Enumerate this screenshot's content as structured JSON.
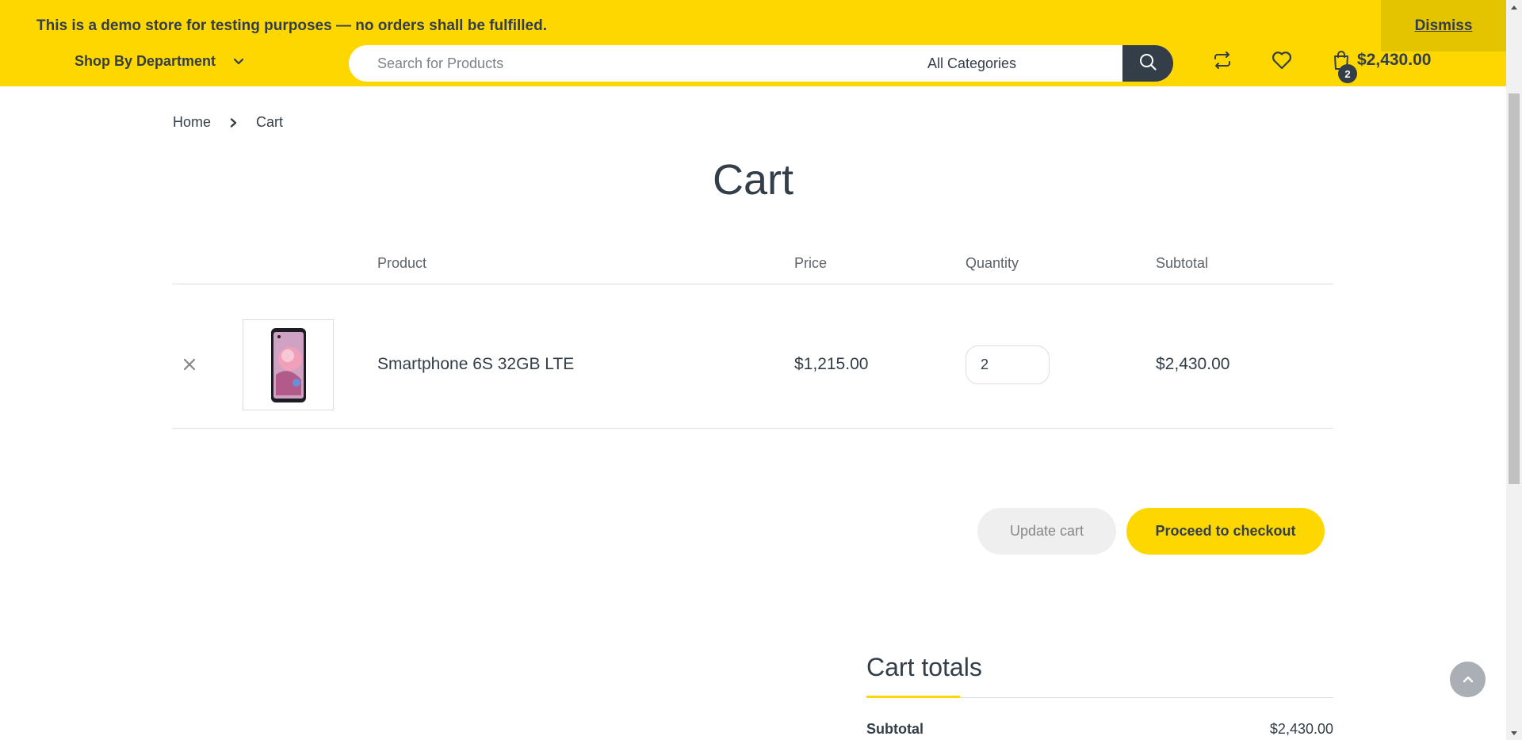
{
  "notice": {
    "text": "This is a demo store for testing purposes — no orders shall be fulfilled.",
    "dismiss_label": "Dismiss"
  },
  "header": {
    "department_label": "Shop By Department",
    "search_placeholder": "Search for Products",
    "category_selected": "All Categories",
    "cart_total": "$2,430.00",
    "cart_count": "2"
  },
  "breadcrumb": {
    "home": "Home",
    "current": "Cart"
  },
  "page": {
    "title": "Cart"
  },
  "cart_table": {
    "columns": [
      "Product",
      "Price",
      "Quantity",
      "Subtotal"
    ],
    "rows": [
      {
        "product": "Smartphone 6S 32GB LTE",
        "price": "$1,215.00",
        "quantity": "2",
        "subtotal": "$2,430.00"
      }
    ]
  },
  "actions": {
    "update_label": "Update cart",
    "checkout_label": "Proceed to checkout"
  },
  "totals": {
    "title": "Cart totals",
    "subtotal_label": "Subtotal",
    "subtotal_value": "$2,430.00"
  },
  "colors": {
    "accent": "#fed700",
    "dark": "#333e48"
  }
}
